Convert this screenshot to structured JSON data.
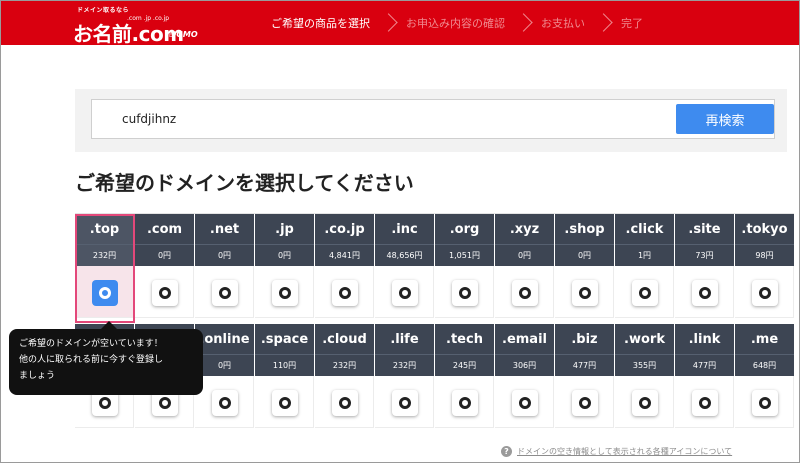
{
  "header": {
    "logo": {
      "tagline": "ドメイン取るなら",
      "tlds": ".com .jp .co.jp",
      "main": "お名前.com",
      "by": "by",
      "company": "GMO"
    },
    "steps": [
      "ご希望の商品を選択",
      "お申込み内容の確認",
      "お支払い",
      "完了"
    ],
    "active_step": 0,
    "brand_color": "#d9000f"
  },
  "search": {
    "value": "cufdjihnz",
    "button_label": "再検索",
    "button_color": "#3e8bef"
  },
  "page_title": "ご希望のドメインを選択してください",
  "domains": {
    "row1": [
      {
        "tld": ".top",
        "price": "232円",
        "selected": true
      },
      {
        "tld": ".com",
        "price": "0円"
      },
      {
        "tld": ".net",
        "price": "0円"
      },
      {
        "tld": ".jp",
        "price": "0円"
      },
      {
        "tld": ".co.jp",
        "price": "4,841円"
      },
      {
        "tld": ".inc",
        "price": "48,656円"
      },
      {
        "tld": ".org",
        "price": "1,051円"
      },
      {
        "tld": ".xyz",
        "price": "0円"
      },
      {
        "tld": ".shop",
        "price": "0円"
      },
      {
        "tld": ".click",
        "price": "1円"
      },
      {
        "tld": ".site",
        "price": "73円"
      },
      {
        "tld": ".tokyo",
        "price": "98円"
      }
    ],
    "row2": [
      {
        "tld": "",
        "price": ""
      },
      {
        "tld": "",
        "price": ""
      },
      {
        "tld": ".online",
        "price": "0円"
      },
      {
        "tld": ".space",
        "price": "110円"
      },
      {
        "tld": ".cloud",
        "price": "232円"
      },
      {
        "tld": ".life",
        "price": "232円"
      },
      {
        "tld": ".tech",
        "price": "245円"
      },
      {
        "tld": ".email",
        "price": "306円"
      },
      {
        "tld": ".biz",
        "price": "477円"
      },
      {
        "tld": ".work",
        "price": "355円"
      },
      {
        "tld": ".link",
        "price": "477円"
      },
      {
        "tld": ".me",
        "price": "648円"
      }
    ],
    "header_color": "#3d4553",
    "selected_color": "#e3487a"
  },
  "tooltip": {
    "lines": [
      "ご希望のドメインが空いています！",
      "他の人に取られる前に今すぐ登録し",
      "ましょう"
    ]
  },
  "help": {
    "icon": "question-circle-icon",
    "link_text": "ドメインの空き情報として表示される各種アイコンについて"
  }
}
